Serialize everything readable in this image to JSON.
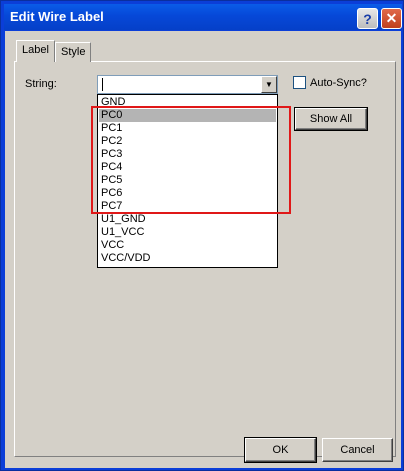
{
  "window": {
    "title": "Edit Wire Label"
  },
  "titlebar": {
    "help_glyph": "?",
    "close_glyph": "✕"
  },
  "tabs": [
    {
      "label": "Label"
    },
    {
      "label": "Style"
    }
  ],
  "form": {
    "string_label": "String:",
    "string_value": "",
    "dropdown_glyph": "▼",
    "autosync_label": "Auto-Sync?",
    "autosync_checked": false,
    "show_all_label": "Show All"
  },
  "list": {
    "selected_index": 1,
    "items": [
      "GND",
      "PC0",
      "PC1",
      "PC2",
      "PC3",
      "PC4",
      "PC5",
      "PC6",
      "PC7",
      "U1_GND",
      "U1_VCC",
      "VCC",
      "VCC/VDD"
    ]
  },
  "footer": {
    "ok_label": "OK",
    "cancel_label": "Cancel"
  },
  "colors": {
    "highlight": "#e01818",
    "selected": "#b4b4b4",
    "titlebar": "#0648d8"
  }
}
